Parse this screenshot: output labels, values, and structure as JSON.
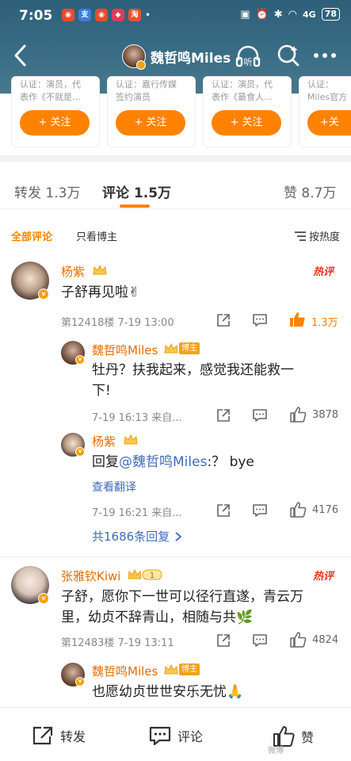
{
  "status": {
    "time": "7:05",
    "battery": "78",
    "signal": "4G"
  },
  "nav": {
    "title": "魏哲鸣Miles",
    "listen_label": "听"
  },
  "recommend": [
    {
      "cert_line1": "认证：演员，代",
      "cert_line2": "表作《不就是…",
      "follow": "+ 关注"
    },
    {
      "cert_line1": "认证：嘉行传媒",
      "cert_line2": "签约演员",
      "follow": "+ 关注"
    },
    {
      "cert_line1": "认证：演员，代",
      "cert_line2": "表作《最食人…",
      "follow": "+ 关注"
    },
    {
      "cert_line1": "认证：",
      "cert_line2": "Miles官方",
      "follow": "+关"
    }
  ],
  "tabs": {
    "repost": "转发 1.3万",
    "comment": "评论 1.5万",
    "like": "赞 8.7万"
  },
  "filters": {
    "all": "全部评论",
    "host_only": "只看博主",
    "sort": "按热度"
  },
  "comments": [
    {
      "user": "杨紫",
      "text": "子舒再见啦✌",
      "hot": "热评",
      "floor": "第12418楼  7-19 13:00",
      "likes": "1.3万",
      "replies": [
        {
          "user": "魏哲鸣Miles",
          "badge": "博主",
          "text_line1": "牡丹？扶我起来，感觉我还能救一",
          "text_line2": "下!",
          "meta": "7-19 16:13  来自...",
          "likes": "3878"
        },
        {
          "user": "杨紫",
          "text_prefix": "回复",
          "mention": "@魏哲鸣Miles",
          "text_suffix": ":？ bye",
          "translate": "查看翻译",
          "meta": "7-19 16:21  来自...",
          "likes": "4176"
        }
      ],
      "total_replies": "共1686条回复"
    },
    {
      "user": "张雅钦Kiwi",
      "level": "1",
      "text_line1": "子舒，愿你下一世可以径行直遂，青云万",
      "text_line2": "里，幼贞不辞青山，相随与共🌿",
      "hot": "热评",
      "floor": "第12483楼  7-19 13:11",
      "likes": "4824",
      "replies": [
        {
          "user": "魏哲鸣Miles",
          "badge": "博主",
          "text": "也愿幼贞世世安乐无忧🙏"
        }
      ]
    }
  ],
  "bottom": {
    "repost": "转发",
    "comment": "评论",
    "like": "赞"
  },
  "watermark": "微博"
}
